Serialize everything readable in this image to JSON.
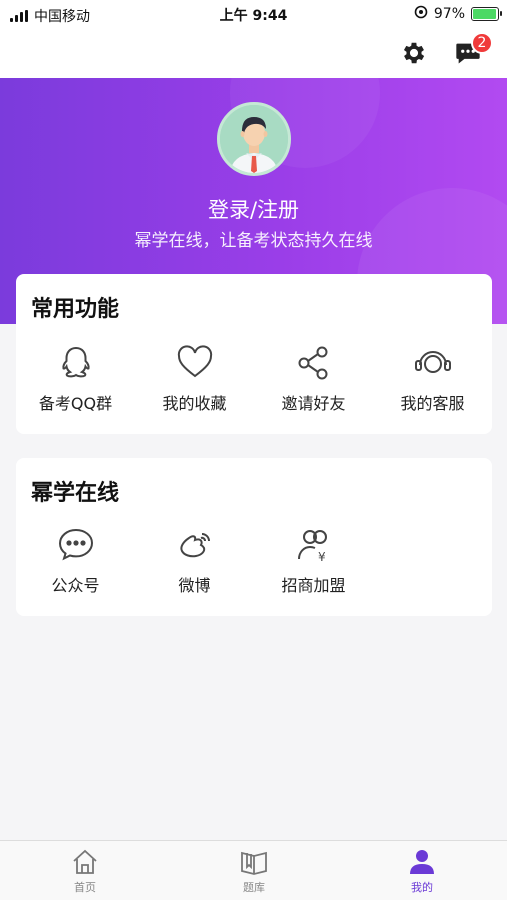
{
  "status_bar": {
    "carrier": "中国移动",
    "time": "上午 9:44",
    "battery": "97%"
  },
  "top_nav": {
    "settings_icon": "gear-icon",
    "messages_icon": "chat-icon",
    "message_badge": "2"
  },
  "profile": {
    "login_label": "登录/注册",
    "slogan": "幂学在线，让备考状态持久在线"
  },
  "common_features": {
    "title": "常用功能",
    "items": [
      {
        "label": "备考QQ群",
        "icon": "qq-icon"
      },
      {
        "label": "我的收藏",
        "icon": "heart-icon"
      },
      {
        "label": "邀请好友",
        "icon": "share-icon"
      },
      {
        "label": "我的客服",
        "icon": "headset-icon"
      }
    ]
  },
  "mixue_online": {
    "title": "幂学在线",
    "items": [
      {
        "label": "公众号",
        "icon": "wechat-icon"
      },
      {
        "label": "微博",
        "icon": "weibo-icon"
      },
      {
        "label": "招商加盟",
        "icon": "franchise-icon"
      }
    ]
  },
  "tab_bar": {
    "tabs": [
      {
        "label": "首页",
        "icon": "home-icon"
      },
      {
        "label": "题库",
        "icon": "book-icon"
      },
      {
        "label": "我的",
        "icon": "user-icon",
        "active": true
      }
    ],
    "active_color": "#6b3ad6"
  },
  "colors": {
    "gradient_start": "#7b3bdc",
    "gradient_end": "#b24af1",
    "badge": "#f03a3a"
  }
}
